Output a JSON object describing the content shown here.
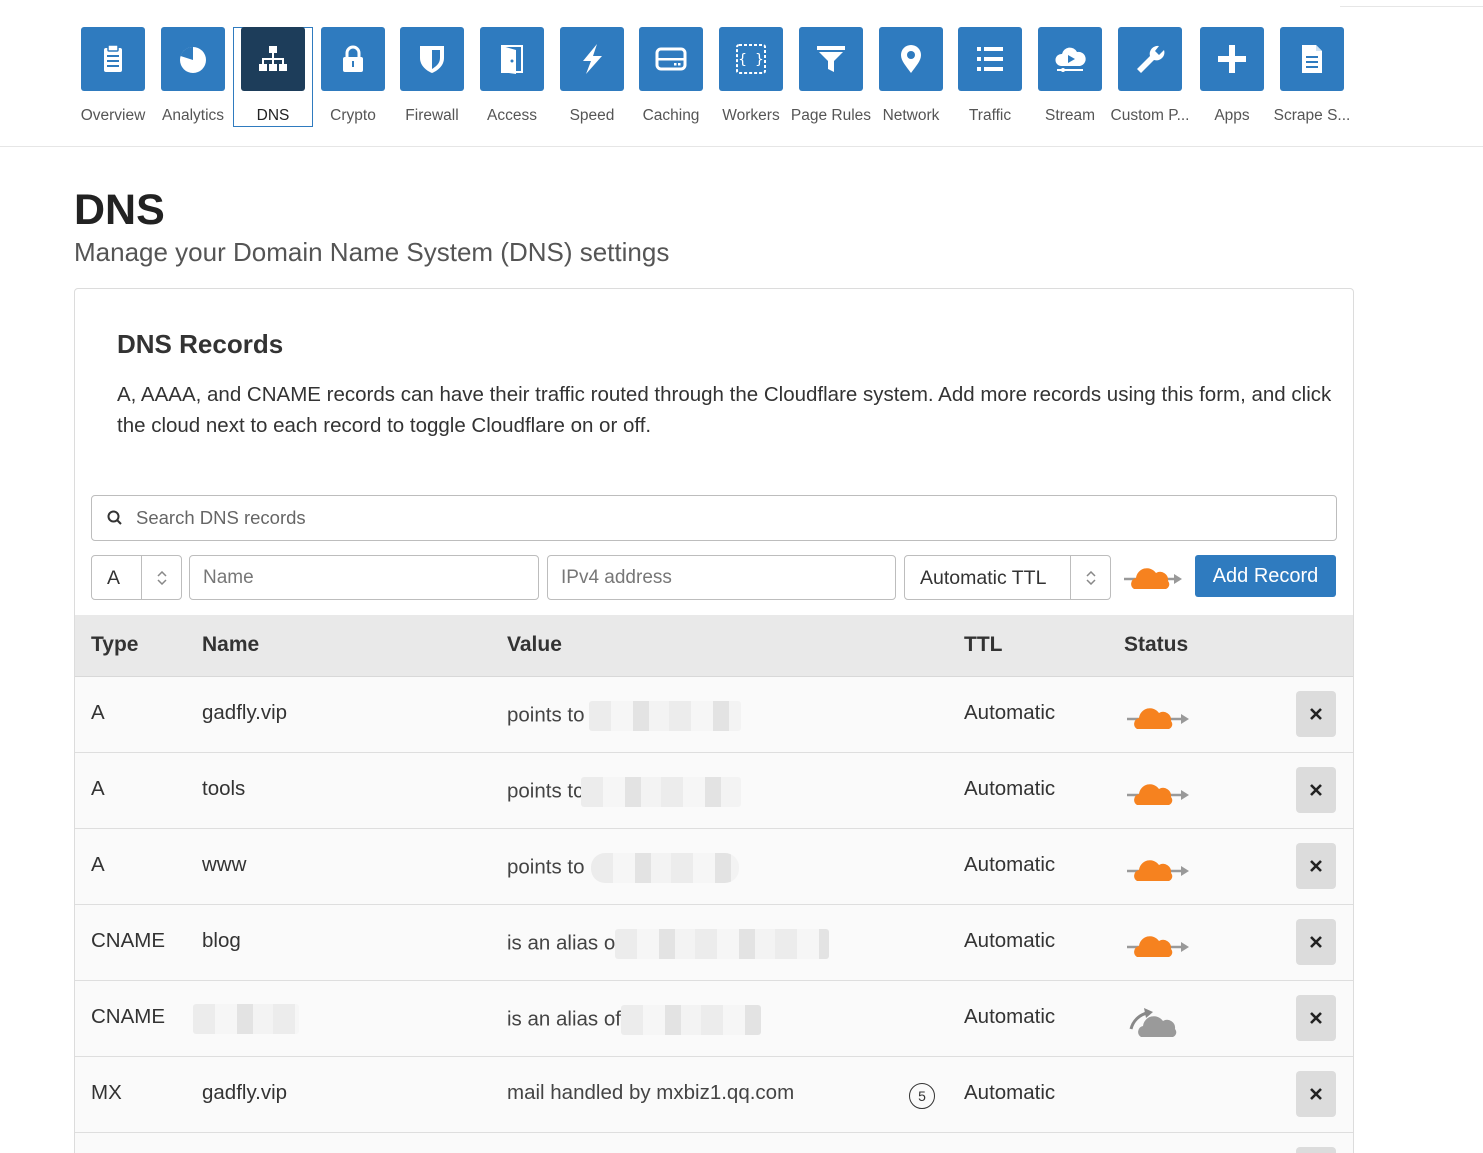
{
  "nav": {
    "items": [
      {
        "label": "Overview",
        "icon": "clipboard-icon"
      },
      {
        "label": "Analytics",
        "icon": "pie-chart-icon"
      },
      {
        "label": "DNS",
        "icon": "sitemap-icon",
        "active": true
      },
      {
        "label": "Crypto",
        "icon": "lock-icon"
      },
      {
        "label": "Firewall",
        "icon": "shield-icon"
      },
      {
        "label": "Access",
        "icon": "door-icon"
      },
      {
        "label": "Speed",
        "icon": "lightning-icon"
      },
      {
        "label": "Caching",
        "icon": "hard-drive-icon"
      },
      {
        "label": "Workers",
        "icon": "code-braces-icon"
      },
      {
        "label": "Page Rules",
        "icon": "filter-icon"
      },
      {
        "label": "Network",
        "icon": "map-pin-icon"
      },
      {
        "label": "Traffic",
        "icon": "list-icon"
      },
      {
        "label": "Stream",
        "icon": "cloud-play-icon"
      },
      {
        "label": "Custom P...",
        "icon": "wrench-icon"
      },
      {
        "label": "Apps",
        "icon": "plus-icon"
      },
      {
        "label": "Scrape S...",
        "icon": "document-icon"
      }
    ]
  },
  "page": {
    "title": "DNS",
    "subtitle": "Manage your Domain Name System (DNS) settings"
  },
  "card": {
    "title": "DNS Records",
    "description": "A, AAAA, and CNAME records can have their traffic routed through the Cloudflare system. Add more records using this form, and click the cloud next to each record to toggle Cloudflare on or off."
  },
  "search": {
    "placeholder": "Search DNS records",
    "value": ""
  },
  "form": {
    "type_value": "A",
    "name_placeholder": "Name",
    "value_placeholder": "IPv4 address",
    "ttl_value": "Automatic TTL",
    "add_label": "Add Record",
    "proxy_icon": "cloud-proxied-icon"
  },
  "table": {
    "headers": [
      "Type",
      "Name",
      "Value",
      "TTL",
      "Status"
    ],
    "rows": [
      {
        "type": "A",
        "name": "gadfly.vip",
        "value_prefix": "points to",
        "ttl": "Automatic",
        "status": "proxied"
      },
      {
        "type": "A",
        "name": "tools",
        "value_prefix": "points tc",
        "ttl": "Automatic",
        "status": "proxied"
      },
      {
        "type": "A",
        "name": "www",
        "value_prefix": "points to",
        "ttl": "Automatic",
        "status": "proxied"
      },
      {
        "type": "CNAME",
        "name": "blog",
        "value_prefix": "is an alias of",
        "ttl": "Automatic",
        "status": "proxied"
      },
      {
        "type": "CNAME",
        "name": "",
        "value_prefix": "is an alias of",
        "ttl": "Automatic",
        "status": "dns-only"
      },
      {
        "type": "MX",
        "name": "gadfly.vip",
        "value_prefix": "mail handled by mxbiz1.qq.com",
        "priority": "5",
        "ttl": "Automatic",
        "status": "none"
      }
    ]
  },
  "colors": {
    "accent": "#2f7bbf",
    "active_tile": "#1d3d5a",
    "cloud_orange": "#f6821f",
    "cloud_gray": "#9a9a9a"
  }
}
